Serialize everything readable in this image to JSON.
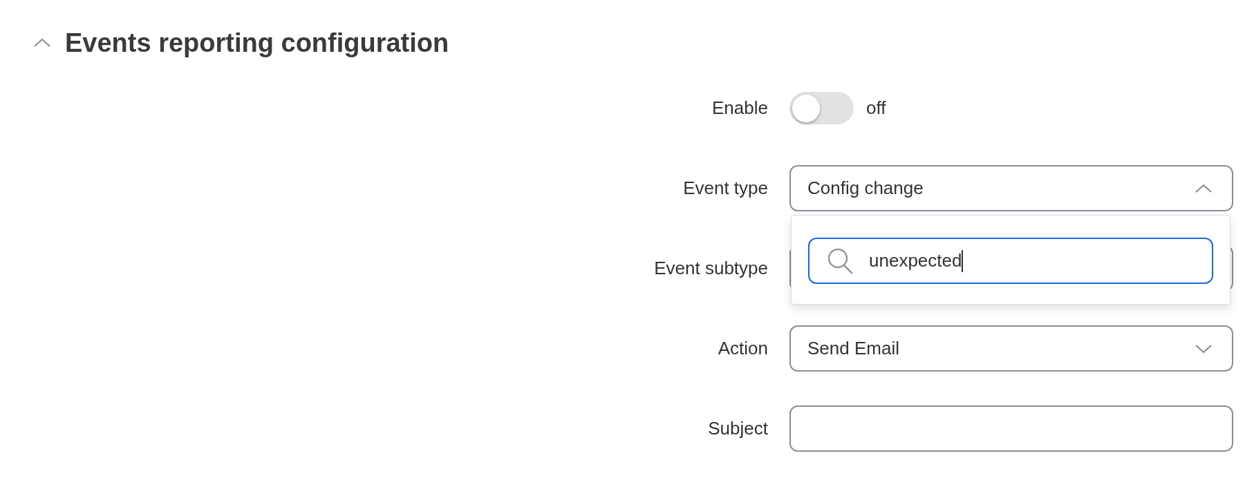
{
  "section": {
    "title": "Events reporting configuration",
    "expanded": true
  },
  "fields": [
    {
      "kind": "toggle",
      "label": "Enable",
      "on": false,
      "status": "off"
    },
    {
      "kind": "select",
      "label": "Event type",
      "value": "Config change",
      "expanded": true,
      "search": {
        "value": "unexpected"
      }
    },
    {
      "kind": "select",
      "label": "Event subtype",
      "expanded": false
    },
    {
      "kind": "select",
      "label": "Action",
      "value": "Send Email",
      "expanded": false
    },
    {
      "kind": "text",
      "label": "Subject"
    }
  ]
}
